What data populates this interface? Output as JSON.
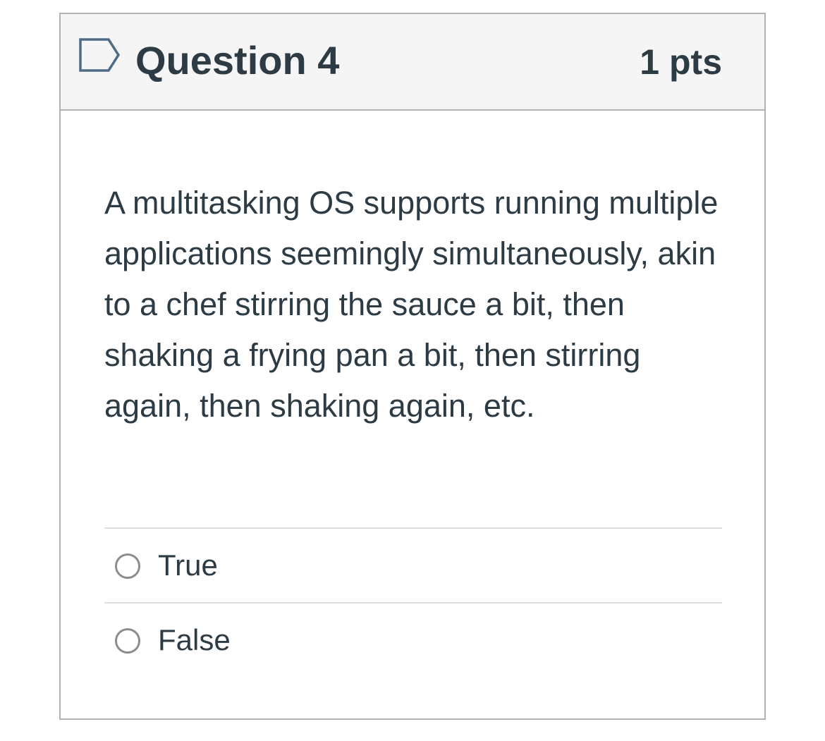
{
  "question": {
    "title": "Question 4",
    "points": "1 pts",
    "flag_icon": "flag-outline-icon",
    "text": "A multitasking OS supports running multiple applications seemingly simultaneously, akin to a chef stirring the sauce a bit, then shaking a frying pan a bit, then stirring again, then shaking again, etc.",
    "answers": [
      {
        "label": "True",
        "selected": false
      },
      {
        "label": "False",
        "selected": false
      }
    ]
  },
  "colors": {
    "text": "#2d3b45",
    "header_bg": "#f5f5f5",
    "border": "#b0b3b6",
    "divider": "#dcdee0",
    "radio_border": "#8a8d90",
    "flag_stroke": "#4f6b85"
  }
}
